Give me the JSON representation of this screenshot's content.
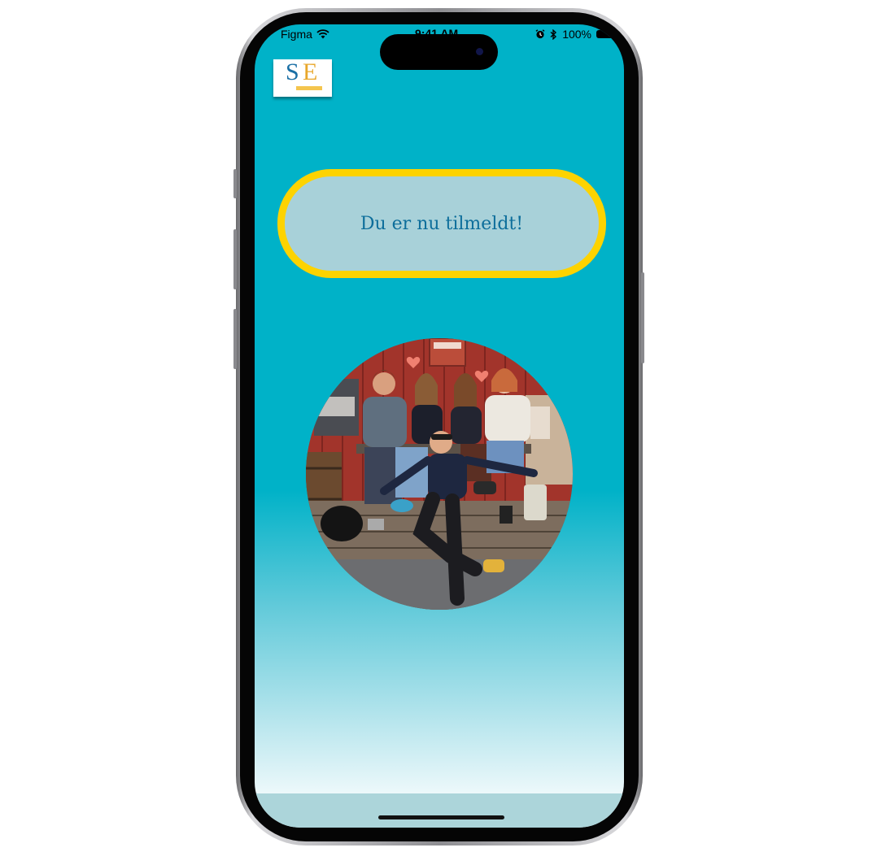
{
  "status_bar": {
    "carrier": "Figma",
    "time": "9:41 AM",
    "battery": "100%",
    "icons": [
      "wifi-icon",
      "alarm-icon",
      "bluetooth-icon",
      "battery-icon"
    ]
  },
  "logo": {
    "letters": "SE"
  },
  "confirmation": {
    "message": "Du er nu tilmeldt!"
  },
  "photo": {
    "description_alt": "Group photo"
  },
  "colors": {
    "background_top": "#00b2c8",
    "pill_border": "#fdd300",
    "pill_fill": "#a8d1d9",
    "pill_text": "#0d6e9b"
  }
}
